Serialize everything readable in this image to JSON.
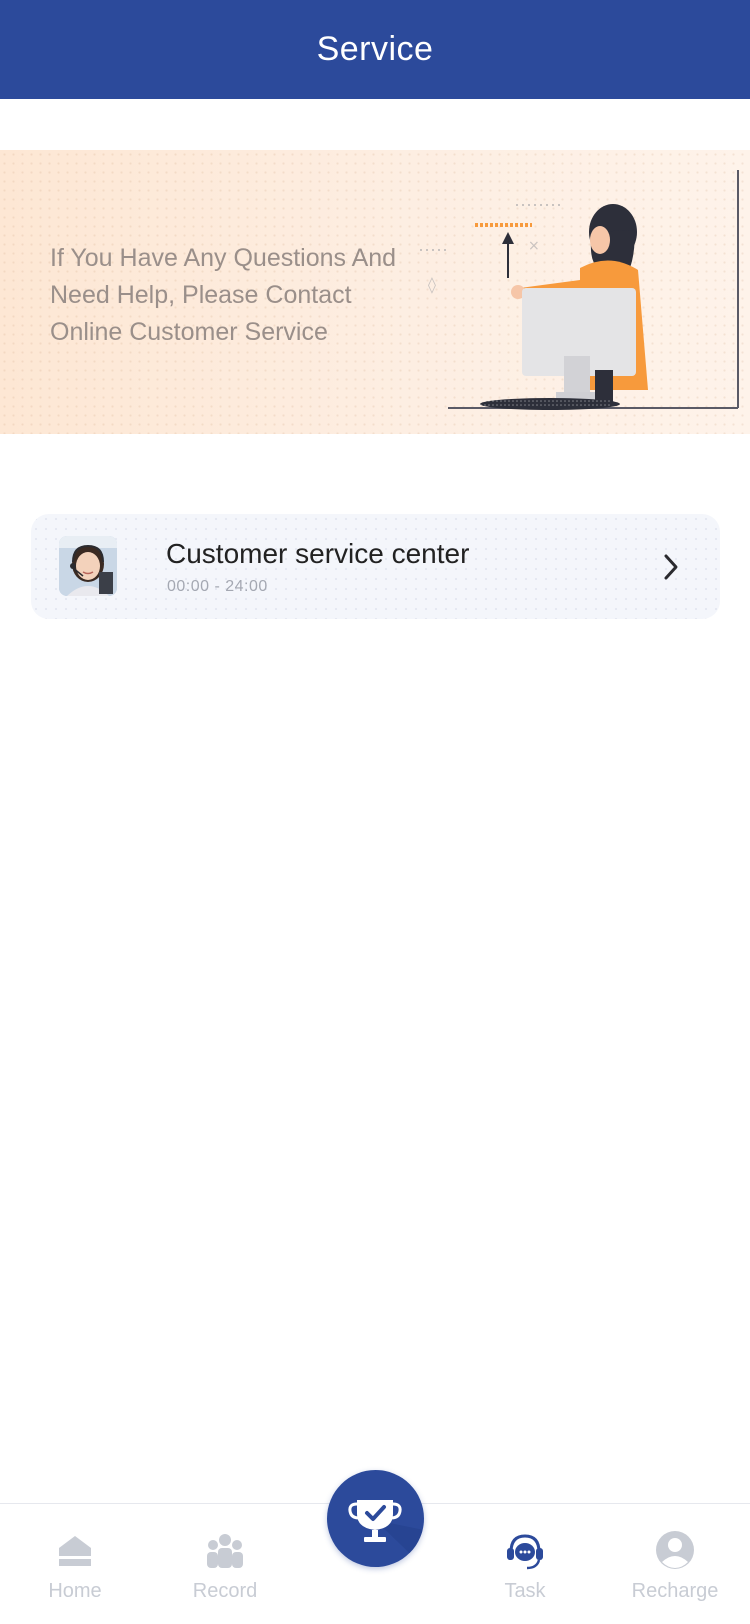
{
  "header": {
    "title": "Service"
  },
  "banner": {
    "text": "If You Have Any Questions And Need Help, Please Contact Online Customer Service"
  },
  "service_card": {
    "title": "Customer service center",
    "hours": "00:00 - 24:00",
    "avatar_icon": "agent-avatar",
    "chevron_icon": "chevron-right-icon"
  },
  "tabbar": {
    "items": [
      {
        "label": "Home",
        "icon": "home-icon",
        "active": false
      },
      {
        "label": "Record",
        "icon": "users-icon",
        "active": false
      },
      {
        "label": "",
        "icon": "trophy-check-icon",
        "active": false
      },
      {
        "label": "Task",
        "icon": "headset-chat-icon",
        "active": true
      },
      {
        "label": "Recharge",
        "icon": "user-circle-icon",
        "active": false
      }
    ]
  },
  "colors": {
    "primary": "#2c4a9b",
    "banner_bg": "#fde7d4",
    "inactive": "#c8ccd4",
    "accent_orange": "#f79a3c"
  }
}
